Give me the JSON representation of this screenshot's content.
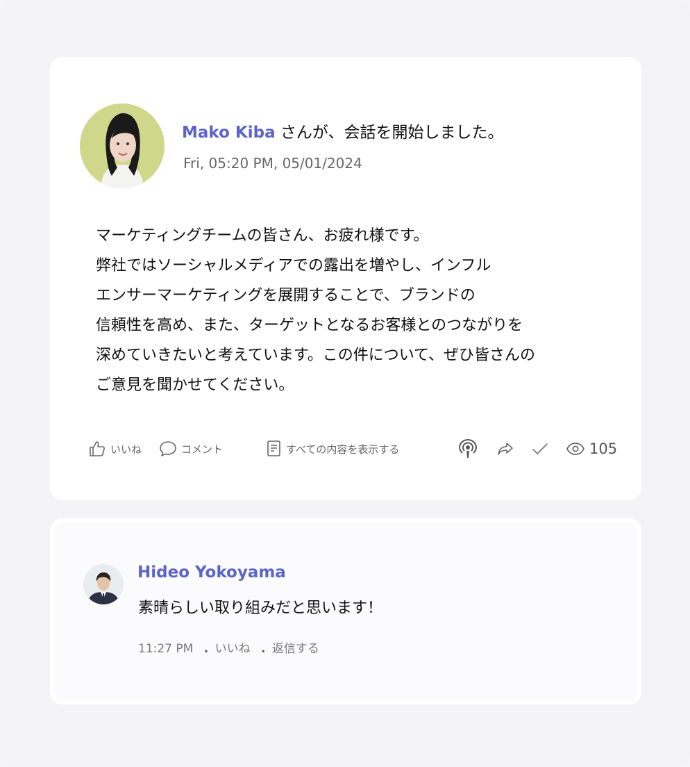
{
  "post": {
    "author": "Mako Kiba",
    "headline_suffix": "さんが、会話を開始しました。",
    "timestamp": "Fri, 05:20 PM, 05/01/2024",
    "body_lines": [
      "マーケティングチームの皆さん、お疲れ様です。",
      "弊社ではソーシャルメディアでの露出を増やし、インフル",
      "エンサーマーケティングを展開することで、ブランドの",
      "信頼性を高め、また、ターゲットとなるお客様とのつながりを",
      "深めていきたいと考えています。この件について、ぜひ皆さんの",
      "ご意見を聞かせてください。"
    ],
    "actions": {
      "like_label": "いいね",
      "comment_label": "コメント",
      "show_all_label": "すべての内容を表示する",
      "view_count": "105"
    }
  },
  "comment": {
    "author": "Hideo Yokoyama",
    "text": "素晴らしい取り組みだと思います！",
    "time": "11:27 PM",
    "separator": ".",
    "like_label": "いいね",
    "reply_label": "返信する"
  },
  "colors": {
    "accent": "#5b64c9",
    "avatar_bg": "#cfd88a",
    "page_bg": "#f4f4f6"
  },
  "icons": [
    "thumbs-up-icon",
    "comment-bubble-icon",
    "document-icon",
    "podcast-icon",
    "share-icon",
    "check-icon",
    "eye-icon"
  ]
}
